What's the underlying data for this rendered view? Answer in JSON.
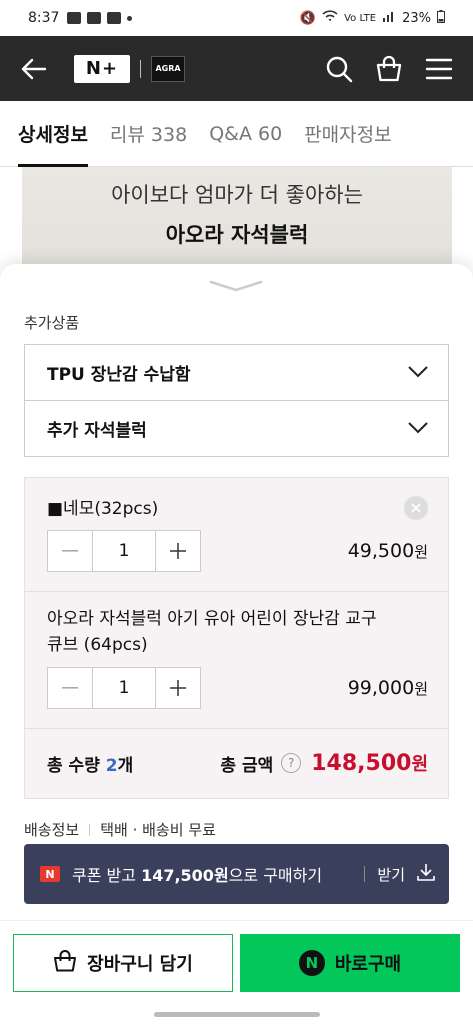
{
  "status_bar": {
    "time": "8:37",
    "network": "Vo LTE",
    "battery": "23%"
  },
  "header": {
    "logo_text": "N+",
    "brand_logo_text": "AGRA",
    "icons": [
      "back-arrow-icon",
      "search-icon",
      "shopping-bag-icon",
      "menu-icon"
    ]
  },
  "tabs": [
    {
      "label": "상세정보",
      "active": true
    },
    {
      "label": "리뷰 338",
      "active": false
    },
    {
      "label": "Q&A 60",
      "active": false
    },
    {
      "label": "판매자정보",
      "active": false
    }
  ],
  "banner": {
    "line1": "아이보다 엄마가 더 좋아하는",
    "line2": "아오라 자석블럭"
  },
  "options": {
    "section_label": "추가상품",
    "selects": [
      {
        "label": "TPU 장난감 수납함"
      },
      {
        "label": "추가 자석블럭"
      }
    ]
  },
  "cart": {
    "items": [
      {
        "name": "■네모(32pcs)",
        "qty": "1",
        "price": "49,500",
        "unit": "원"
      },
      {
        "name": "아오라 자석블럭 아기 유아 어린이 장난감 교구 큐브 (64pcs)",
        "qty": "1",
        "price": "99,000",
        "unit": "원"
      }
    ],
    "total_qty_label": "총 수량",
    "total_qty_value": "2",
    "total_qty_unit": "개",
    "total_amount_label": "총 금액",
    "help_symbol": "?",
    "total_amount": "148,500",
    "total_unit": "원"
  },
  "shipping": {
    "label": "배송정보",
    "value": "택배 · 배송비 무료"
  },
  "coupon": {
    "badge": "N",
    "prefix": "쿠폰 받고 ",
    "amount": "147,500원",
    "suffix": "으로 구매하기",
    "action": "받기"
  },
  "buttons": {
    "cart": "장바구니 담기",
    "buy": "바로구매",
    "buy_badge": "N"
  },
  "colors": {
    "header_bg": "#2a2a2a",
    "accent_green": "#03c75a",
    "price_red": "#c8102e",
    "coupon_bg": "#3a3f5c"
  }
}
